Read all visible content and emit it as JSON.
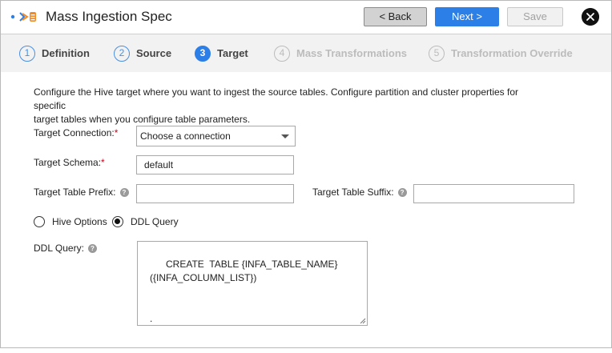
{
  "header": {
    "title": "Mass Ingestion Spec",
    "back_label": "< Back",
    "next_label": "Next >",
    "save_label": "Save"
  },
  "steps": [
    {
      "num": "1",
      "label": "Definition",
      "state": "done"
    },
    {
      "num": "2",
      "label": "Source",
      "state": "done"
    },
    {
      "num": "3",
      "label": "Target",
      "state": "active"
    },
    {
      "num": "4",
      "label": "Mass Transformations",
      "state": "disabled"
    },
    {
      "num": "5",
      "label": "Transformation Override",
      "state": "disabled"
    }
  ],
  "form": {
    "description_line1": "Configure the Hive target where you want to ingest the source tables. Configure partition and cluster properties for specific",
    "description_line2": "target tables when you configure table parameters.",
    "target_connection_label": "Target Connection:",
    "target_connection_value": "Choose a connection",
    "target_schema_label": "Target Schema:",
    "target_schema_value": "default",
    "required_marker": "*",
    "prefix_label": "Target Table Prefix:",
    "prefix_value": "",
    "suffix_label": "Target Table Suffix:",
    "suffix_value": "",
    "help_glyph": "?",
    "radio_hive_label": "Hive Options",
    "radio_ddl_label": "DDL Query",
    "ddl_label": "DDL Query:",
    "ddl_value": "CREATE  TABLE {INFA_TABLE_NAME}\n({INFA_COLUMN_LIST})\n\n\n."
  },
  "colors": {
    "accent": "#2d7fe8",
    "required": "#d0021b"
  },
  "icons": {
    "logo": "ingestion-logo-icon",
    "close": "close-icon",
    "help": "help-icon",
    "dropdown": "chevron-down-icon"
  }
}
